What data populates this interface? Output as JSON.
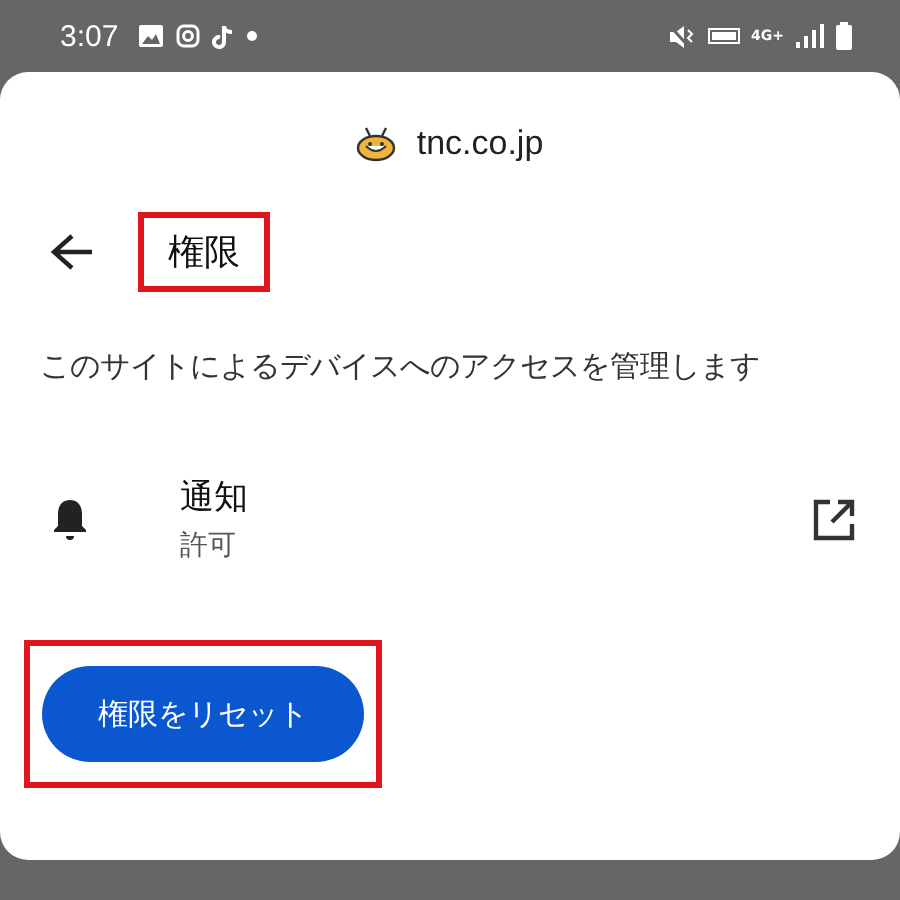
{
  "status_bar": {
    "time": "3:07",
    "network": "4G+"
  },
  "site": {
    "domain": "tnc.co.jp"
  },
  "header": {
    "title": "権限",
    "highlighted": true
  },
  "description": "このサイトによるデバイスへのアクセスを管理します",
  "permissions": [
    {
      "name": "通知",
      "status": "許可"
    }
  ],
  "reset_button": {
    "label": "権限をリセット",
    "highlighted": true
  }
}
